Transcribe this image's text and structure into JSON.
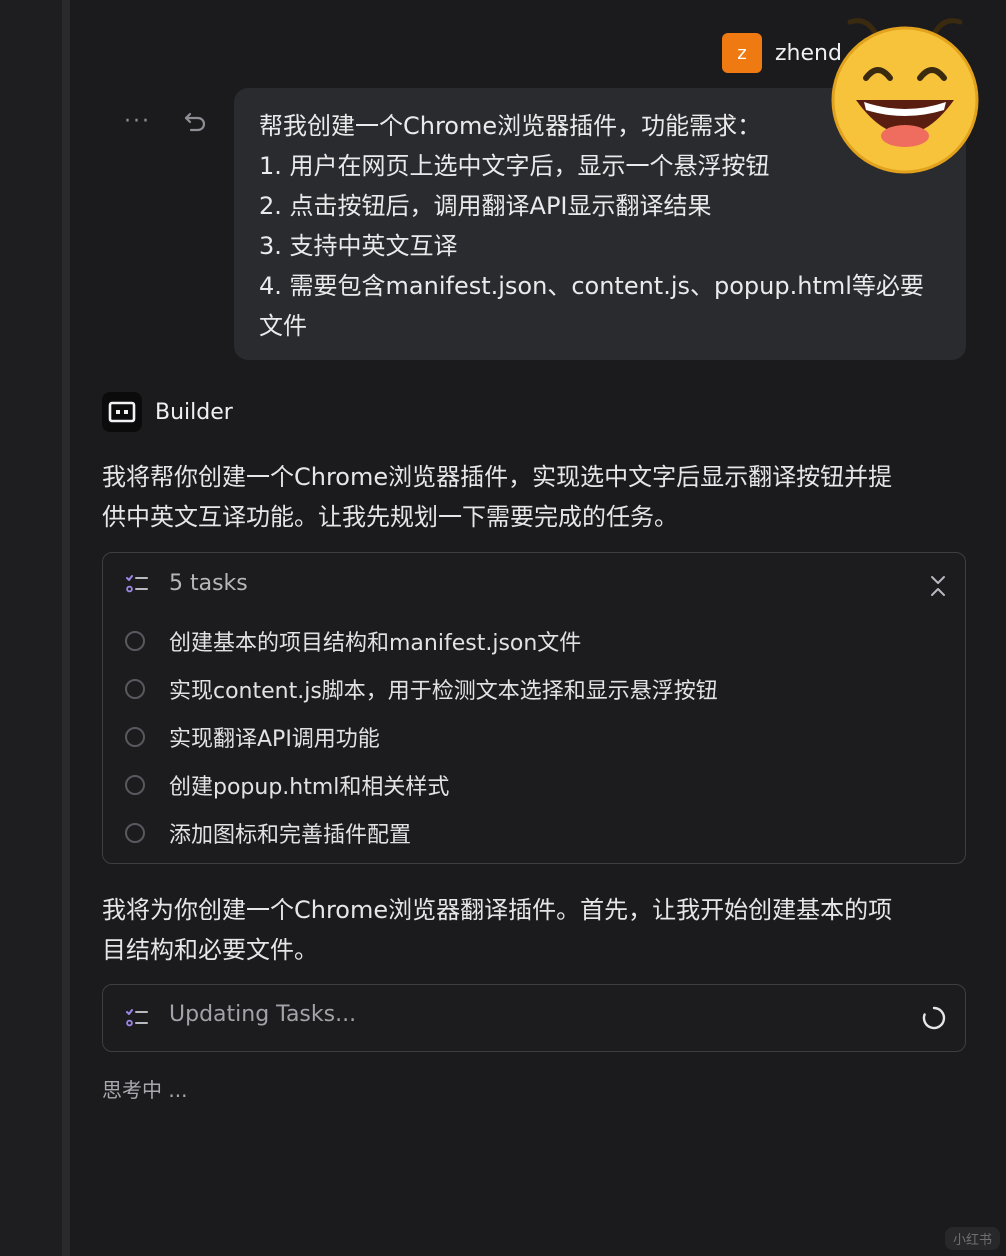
{
  "user": {
    "avatar_letter": "z",
    "name": "zhend"
  },
  "message_tools": {
    "more_icon": "ellipsis-icon",
    "more_glyph": "···",
    "undo_icon": "undo-icon"
  },
  "user_message": {
    "lines": [
      "帮我创建一个Chrome浏览器插件，功能需求：",
      "1. 用户在网页上选中文字后，显示一个悬浮按钮",
      "2. 点击按钮后，调用翻译API显示翻译结果",
      "3. 支持中英文互译",
      "4. 需要包含manifest.json、content.js、popup.html等必要",
      "文件"
    ]
  },
  "assistant": {
    "name": "Builder",
    "intro_lines": [
      "我将帮你创建一个Chrome浏览器插件，实现选中文字后显示翻译按钮并提",
      "供中英文互译功能。让我先规划一下需要完成的任务。"
    ],
    "tasks": {
      "count_label": "5 tasks",
      "items": [
        "创建基本的项目结构和manifest.json文件",
        "实现content.js脚本，用于检测文本选择和显示悬浮按钮",
        "实现翻译API调用功能",
        "创建popup.html和相关样式",
        "添加图标和完善插件配置"
      ]
    },
    "follow_lines": [
      "我将为你创建一个Chrome浏览器翻译插件。首先，让我开始创建基本的项",
      "目结构和必要文件。"
    ],
    "updating_label": "Updating Tasks...",
    "thinking_label": "思考中 ..."
  },
  "watermark": "小红书",
  "colors": {
    "background": "#1b1b1d",
    "bubble": "#2a2b2e",
    "avatar_orange": "#f07a12",
    "card_border": "#3d3e42"
  }
}
